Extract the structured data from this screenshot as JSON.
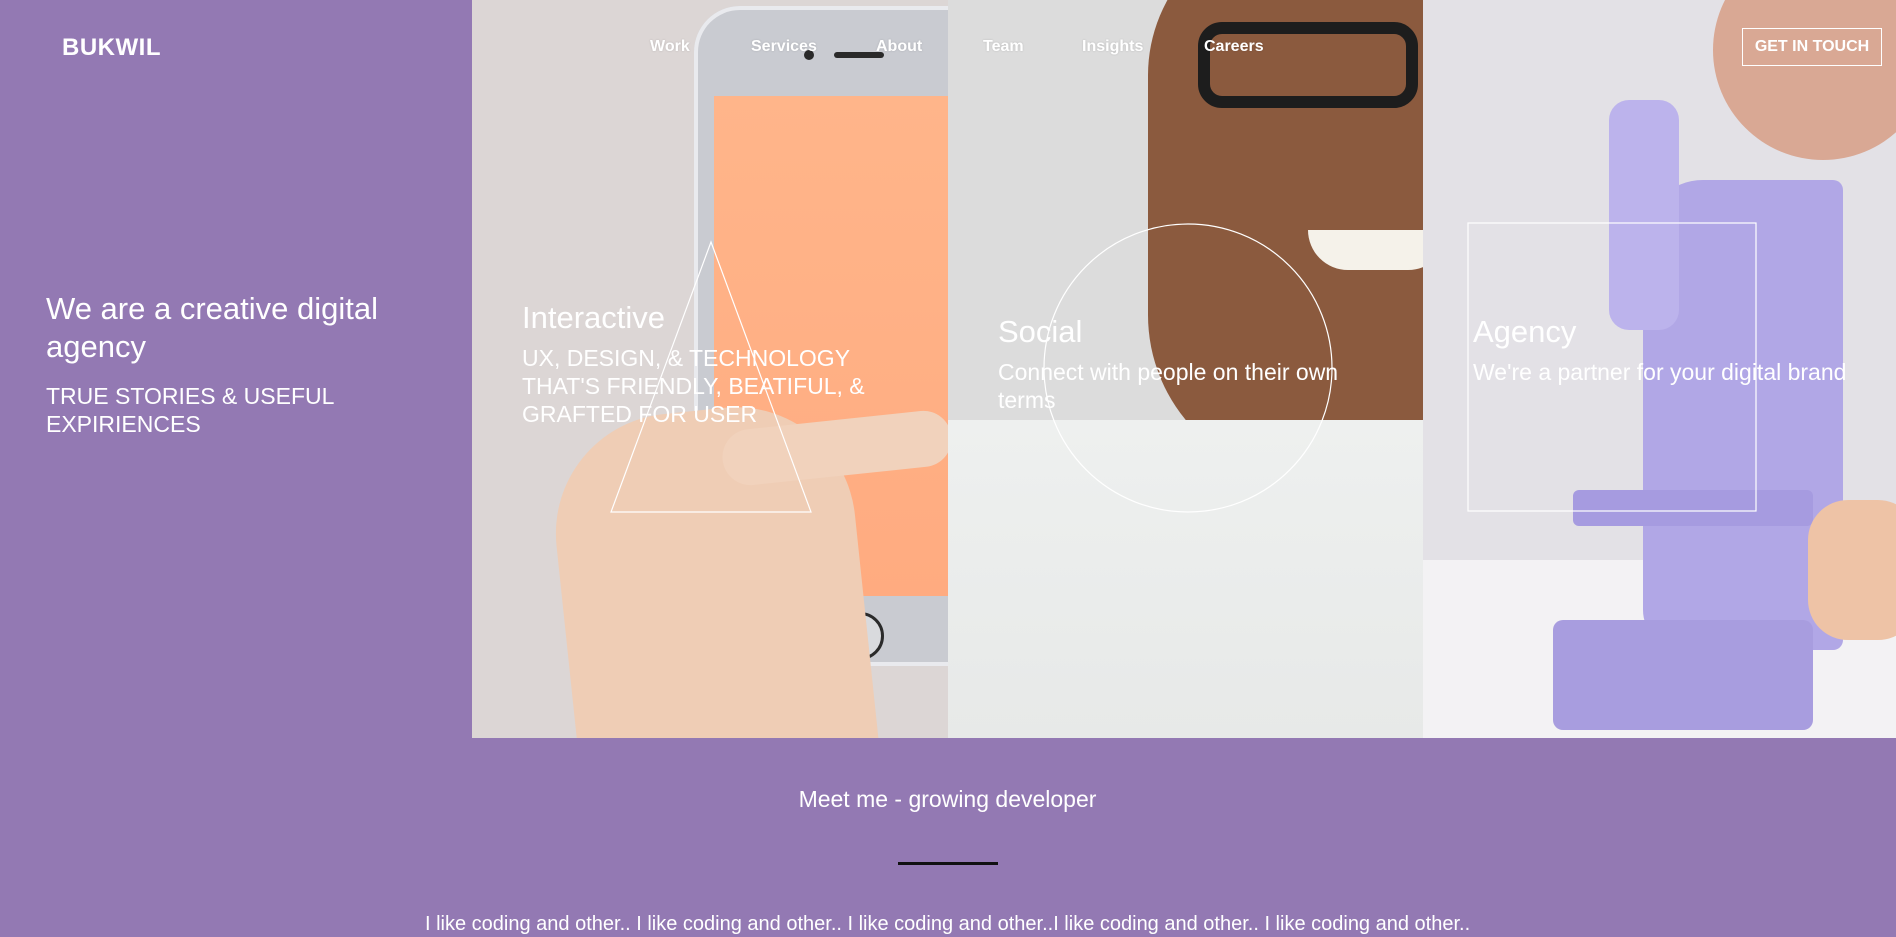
{
  "brand": {
    "logo": "BUKWIL"
  },
  "nav": {
    "items": [
      "Work",
      "Services",
      "About",
      "Team",
      "Insights",
      "Careers"
    ],
    "cta": "GET IN TOUCH"
  },
  "hero": {
    "title": "We are a creative digital agency",
    "subtitle": "TRUE STORIES & USEFUL EXPIRIENCES"
  },
  "panels": [
    {
      "title": "Interactive",
      "text": "UX, DESIGN, & TECHNOLOGY THAT'S FRIENDLY, BEATIFUL, & GRAFTED FOR USER",
      "shape": "triangle-outline"
    },
    {
      "title": "Social",
      "text": "Connect with people on their own terms",
      "shape": "circle-outline"
    },
    {
      "title": "Agency",
      "text": "We're a partner for your digital brand",
      "shape": "square-outline"
    }
  ],
  "meet": {
    "title": "Meet me - growing developer",
    "marquee": "I like coding and other.. I like coding and other.. I like coding and other..I like coding and other.. I like coding and other.."
  },
  "colors": {
    "background": "#9379b3",
    "text": "#ffffff",
    "rule": "#111111"
  }
}
